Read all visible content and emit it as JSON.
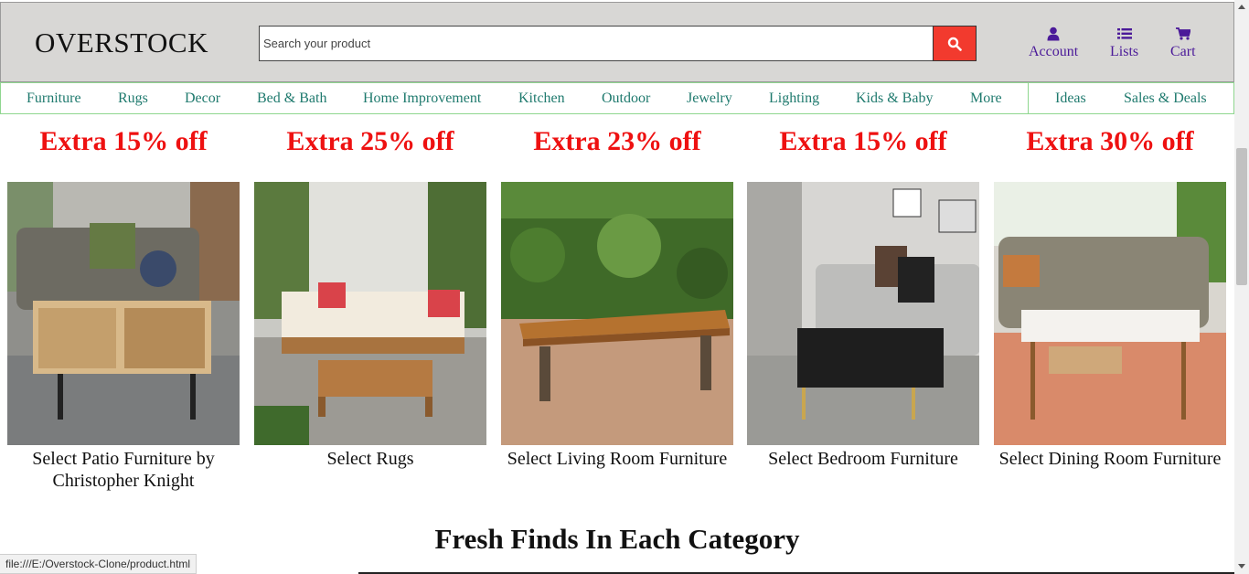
{
  "header": {
    "logo": "OVERSTOCK",
    "search_placeholder": "Search your product",
    "links": [
      {
        "label": "Account",
        "icon": "user-icon"
      },
      {
        "label": "Lists",
        "icon": "list-icon"
      },
      {
        "label": "Cart",
        "icon": "cart-icon"
      }
    ]
  },
  "nav": {
    "items": [
      "Furniture",
      "Rugs",
      "Decor",
      "Bed & Bath",
      "Home Improvement",
      "Kitchen",
      "Outdoor",
      "Jewelry",
      "Lighting",
      "Kids & Baby",
      "More",
      "Ideas",
      "Sales & Deals"
    ]
  },
  "deals": [
    {
      "title": "Extra 15% off",
      "caption": "Select Patio Furniture by Christopher Knight",
      "image": "coffee-table-image"
    },
    {
      "title": "Extra 25% off",
      "caption": "Select Rugs",
      "image": "patio-sofa-set-image"
    },
    {
      "title": "Extra 23% off",
      "caption": "Select Living Room Furniture",
      "image": "wooden-bench-image"
    },
    {
      "title": "Extra 15% off",
      "caption": "Select Bedroom Furniture",
      "image": "black-coffee-table-image"
    },
    {
      "title": "Extra 30% off",
      "caption": "Select Dining Room Furniture",
      "image": "white-coffee-table-image"
    }
  ],
  "section_title": "Fresh Finds In Each Category",
  "status_bar": "file:///E:/Overstock-Clone/product.html",
  "colors": {
    "accent_red": "#ee1111",
    "nav_text": "#1f7a6e",
    "header_link": "#4b1a99",
    "search_button": "#f23a2e"
  }
}
